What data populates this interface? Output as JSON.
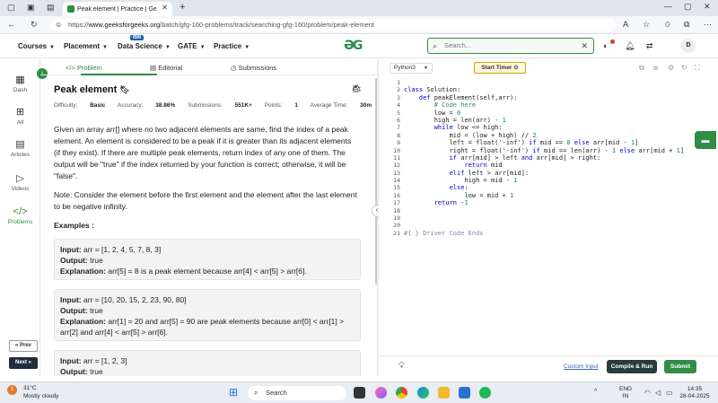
{
  "browser": {
    "tab_title": "Peak element | Practice | GeeksforGeeks",
    "url_prefix": "https://",
    "url_host": "www.geeksforgeeks.org",
    "url_path": "/batch/gfg-160-problems/track/searching-gfg-160/problem/peak-element"
  },
  "header": {
    "nav": [
      {
        "label": "Courses"
      },
      {
        "label": "Placement"
      },
      {
        "label": "Data Science"
      },
      {
        "label": "GATE"
      },
      {
        "label": "Practice"
      }
    ],
    "ibm_badge": "IBM",
    "logo": "GG",
    "search_placeholder": "Search...",
    "avatar": "D"
  },
  "sidebar": {
    "items": [
      {
        "label": "Dash",
        "icon": "dashboard-icon"
      },
      {
        "label": "All",
        "icon": "grid-icon"
      },
      {
        "label": "Articles",
        "icon": "article-icon"
      },
      {
        "label": "Videos",
        "icon": "video-icon"
      },
      {
        "label": "Problems",
        "icon": "code-icon"
      }
    ],
    "prev_label": "« Prev",
    "next_label": "Next »"
  },
  "problem_tabs": {
    "problem": "Problem",
    "editorial": "Editorial",
    "submissions": "Submissions"
  },
  "problem": {
    "title": "Peak element",
    "meta": {
      "difficulty_label": "Difficulty:",
      "difficulty": "Basic",
      "accuracy_label": "Accuracy:",
      "accuracy": "38.86%",
      "submissions_label": "Submissions:",
      "submissions": "551K+",
      "points_label": "Points:",
      "points": "1",
      "time_label": "Average Time:",
      "time": "30m"
    },
    "desc1": "Given an array arr[] where no two adjacent elements are same, find the index of a peak element. An element is considered to be a peak if it is greater than its adjacent elements (if they exist). If there are multiple peak elements, return index of any one of them. The output will be \"true\" if the index returned by your function is correct; otherwise, it will be \"false\".",
    "desc2": "Note: Consider the element before the first element and the element after the last element to be negative infinity.",
    "examples_heading": "Examples :",
    "examples": [
      {
        "input": "arr = [1, 2, 4, 5, 7, 8, 3]",
        "output": "true",
        "explanation": "arr[5] = 8 is a peak element because arr[4] < arr[5] > arr[6]."
      },
      {
        "input": "arr = [10, 20, 15, 2, 23, 90, 80]",
        "output": "true",
        "explanation": "arr[1] = 20 and arr[5] = 90 are peak elements because arr[0] < arr[1] > arr[2] and arr[4] < arr[5] > arr[6]."
      },
      {
        "input": "arr = [1, 2, 3]",
        "output": "true",
        "explanation": ""
      }
    ],
    "labels": {
      "input": "Input:",
      "output": "Output:",
      "explanation": "Explanation:"
    }
  },
  "editor": {
    "language": "Python3",
    "timer_label": "Start Timer",
    "line_numbers": [
      "1",
      "2",
      "3",
      "4",
      "5",
      "6",
      "7",
      "8",
      "9",
      "10",
      "11",
      "12",
      "13",
      "14",
      "15",
      "16",
      "17",
      "18",
      "19",
      "20",
      "21"
    ],
    "code_lines": [
      "",
      "class Solution:",
      "    def peakElement(self,arr):",
      "        # Code here",
      "        low = 0",
      "        high = len(arr) - 1",
      "        while low <= high:",
      "            mid = (low + high) // 2",
      "            left = float('-inf') if mid == 0 else arr[mid - 1]",
      "            right = float('-inf') if mid == len(arr) - 1 else arr[mid + 1]",
      "            if arr[mid] > left and arr[mid] > right:",
      "                return mid",
      "            elif left > arr[mid]:",
      "                high = mid - 1",
      "            else:",
      "                low = mid + 1",
      "        return -1",
      "",
      "",
      "",
      "#{ } Driver Code Ends"
    ],
    "custom_input": "Custom Input",
    "compile_run": "Compile & Run",
    "submit": "Submit"
  },
  "taskbar": {
    "weather_temp": "31°C",
    "weather_desc": "Mostly cloudy",
    "search": "Search",
    "lang1": "ENG",
    "lang2": "IN",
    "time": "14:35",
    "date": "28-04-2025",
    "notif_count": "1"
  },
  "colors": {
    "brand": "#2f8d46",
    "submit": "#2f8d46",
    "compile": "#2a3b3f"
  }
}
